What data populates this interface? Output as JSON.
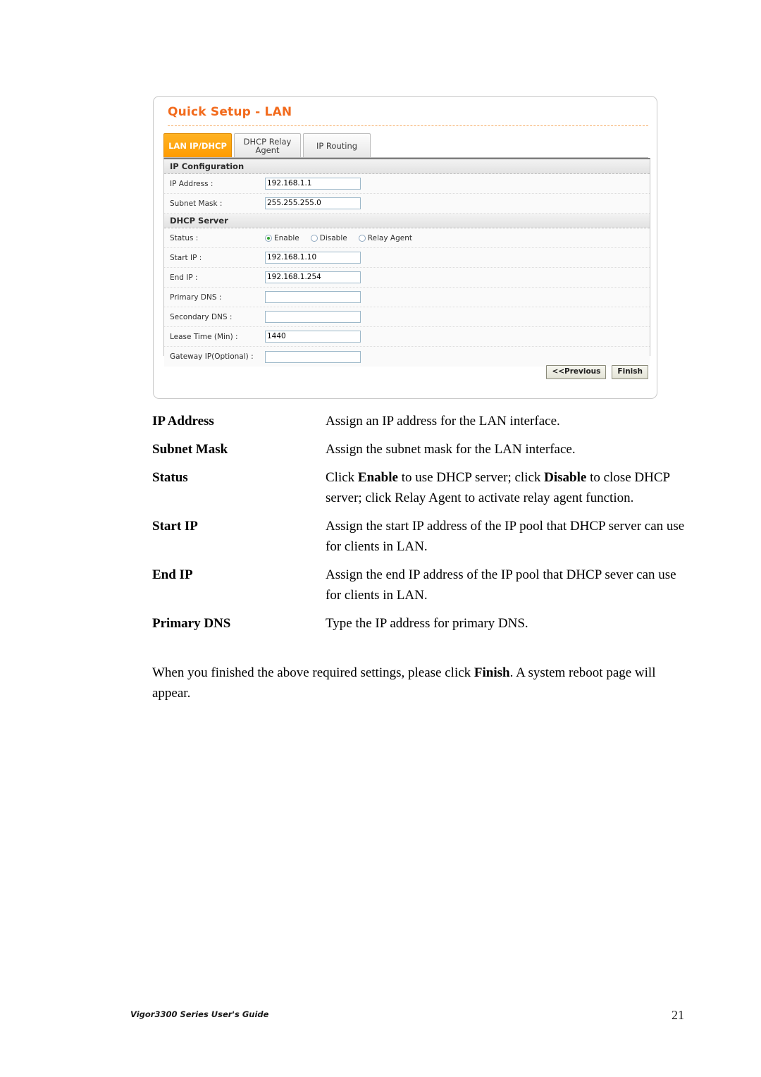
{
  "screenshot": {
    "title": "Quick Setup - LAN",
    "accent_color": "#f26b1d",
    "active_tab_color": "#ff9b00",
    "tabs": [
      {
        "label": "LAN IP/DHCP",
        "active": true
      },
      {
        "label": "DHCP Relay Agent",
        "active": false
      },
      {
        "label": "IP Routing",
        "active": false
      }
    ],
    "sections": [
      {
        "heading": "IP Configuration",
        "rows": [
          {
            "label": "IP Address :",
            "type": "text",
            "value": "192.168.1.1"
          },
          {
            "label": "Subnet Mask :",
            "type": "text",
            "value": "255.255.255.0"
          }
        ]
      },
      {
        "heading": "DHCP Server",
        "rows": [
          {
            "label": "Status :",
            "type": "radio",
            "options": [
              {
                "label": "Enable",
                "checked": true
              },
              {
                "label": "Disable",
                "checked": false
              },
              {
                "label": "Relay Agent",
                "checked": false
              }
            ]
          },
          {
            "label": "Start IP :",
            "type": "text",
            "value": "192.168.1.10"
          },
          {
            "label": "End IP :",
            "type": "text",
            "value": "192.168.1.254"
          },
          {
            "label": "Primary DNS :",
            "type": "text",
            "value": ""
          },
          {
            "label": "Secondary DNS :",
            "type": "text",
            "value": ""
          },
          {
            "label": "Lease Time (Min) :",
            "type": "text",
            "value": "1440"
          },
          {
            "label": "Gateway IP(Optional) :",
            "type": "text",
            "value": ""
          }
        ]
      }
    ],
    "buttons": {
      "previous": "<<Previous",
      "finish": "Finish"
    }
  },
  "definitions": [
    {
      "term": "IP Address",
      "desc_html": "Assign an IP address for the LAN interface."
    },
    {
      "term": "Subnet Mask",
      "desc_html": "Assign the subnet mask for the LAN interface."
    },
    {
      "term": "Status",
      "desc_html": "Click <b>Enable</b> to use DHCP server; click <b>Disable</b> to close DHCP server; click Relay Agent to activate relay agent function."
    },
    {
      "term": "Start IP",
      "desc_html": "Assign the start IP address of the IP pool that DHCP server can use for clients in LAN."
    },
    {
      "term": "End IP",
      "desc_html": "Assign the end IP address of the IP pool that DHCP sever can use for clients in LAN."
    },
    {
      "term": "Primary DNS",
      "desc_html": "Type the IP address for primary DNS."
    }
  ],
  "paragraph_html": "When you finished the above required settings, please click <b>Finish</b>. A system reboot page will appear.",
  "footer": {
    "left": "Vigor3300 Series User's Guide",
    "page": "21"
  }
}
